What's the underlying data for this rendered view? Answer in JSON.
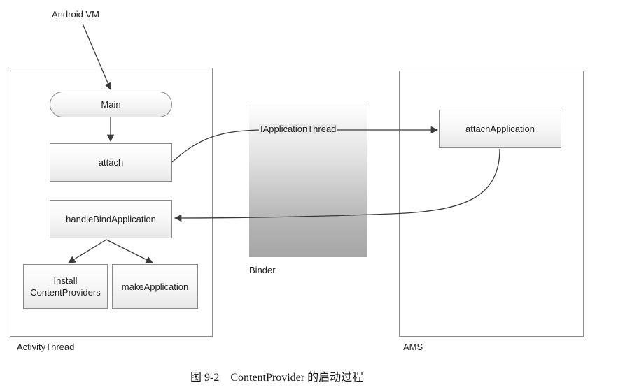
{
  "entry": {
    "label": "Android VM"
  },
  "activity_thread": {
    "label": "ActivityThread",
    "main": "Main",
    "attach": "attach",
    "handle_bind": "handleBindApplication",
    "install_line1": "Install",
    "install_line2": "ContentProviders",
    "make_app": "makeApplication"
  },
  "binder": {
    "label": "Binder",
    "interface": "IApplicationThread"
  },
  "ams": {
    "label": "AMS",
    "attach_application": "attachApplication"
  },
  "figure_caption": "图 9-2    ContentProvider 的启动过程"
}
